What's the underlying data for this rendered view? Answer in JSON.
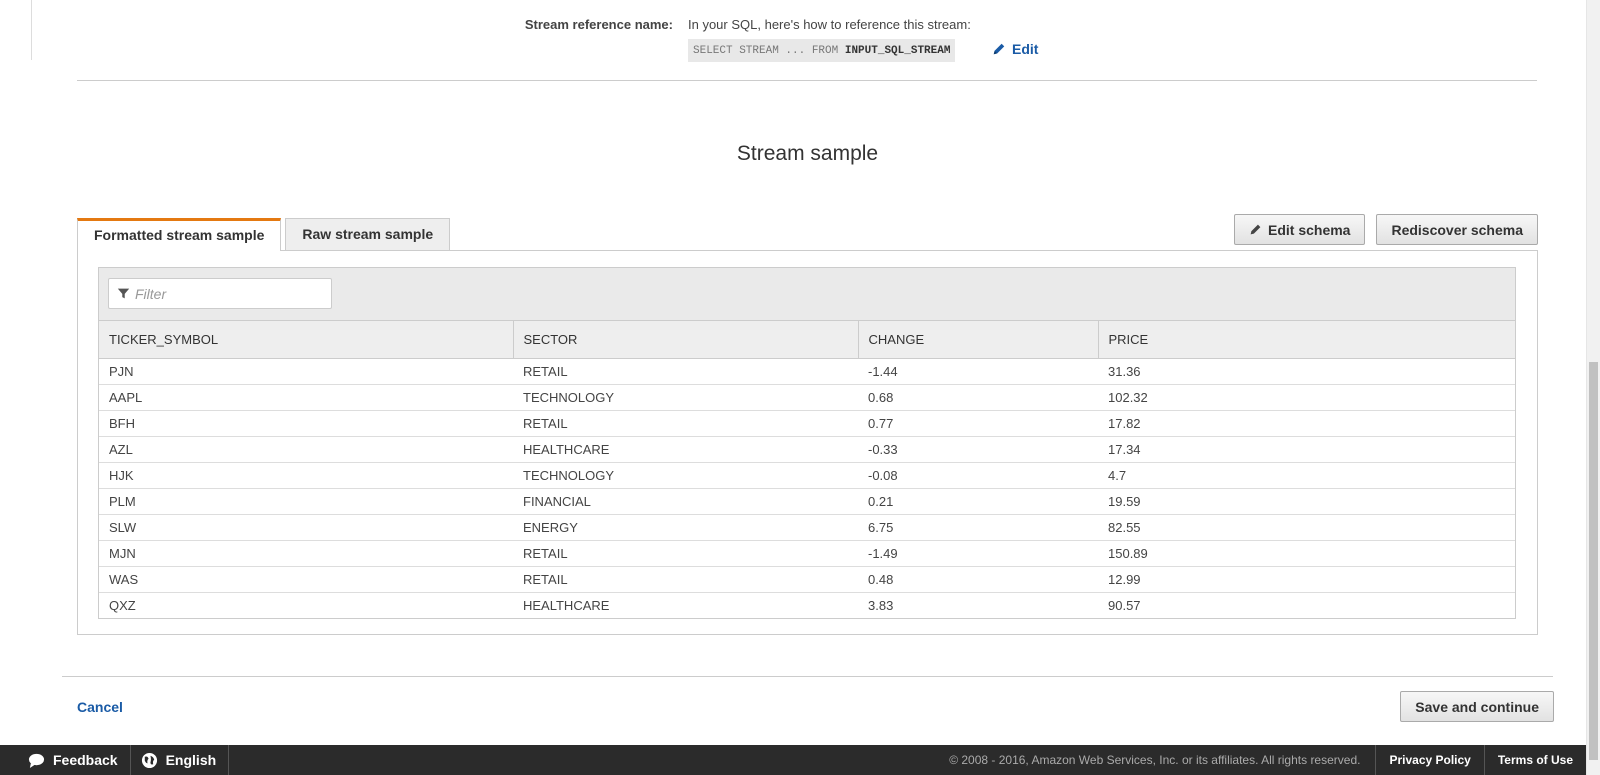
{
  "stream_reference": {
    "label": "Stream reference name:",
    "help_text": "In your SQL, here's how to reference this stream:",
    "code_prefix": "SELECT STREAM ... FROM",
    "code_stream": "INPUT_SQL_STREAM",
    "edit_label": "Edit"
  },
  "section_title": "Stream sample",
  "tabs": [
    {
      "label": "Formatted stream sample",
      "active": true
    },
    {
      "label": "Raw stream sample",
      "active": false
    }
  ],
  "schema_buttons": {
    "edit_schema": "Edit schema",
    "rediscover_schema": "Rediscover schema"
  },
  "filter": {
    "placeholder": "Filter",
    "value": ""
  },
  "table": {
    "columns": [
      "TICKER_SYMBOL",
      "SECTOR",
      "CHANGE",
      "PRICE"
    ],
    "rows": [
      [
        "PJN",
        "RETAIL",
        "-1.44",
        "31.36"
      ],
      [
        "AAPL",
        "TECHNOLOGY",
        "0.68",
        "102.32"
      ],
      [
        "BFH",
        "RETAIL",
        "0.77",
        "17.82"
      ],
      [
        "AZL",
        "HEALTHCARE",
        "-0.33",
        "17.34"
      ],
      [
        "HJK",
        "TECHNOLOGY",
        "-0.08",
        "4.7"
      ],
      [
        "PLM",
        "FINANCIAL",
        "0.21",
        "19.59"
      ],
      [
        "SLW",
        "ENERGY",
        "6.75",
        "82.55"
      ],
      [
        "MJN",
        "RETAIL",
        "-1.49",
        "150.89"
      ],
      [
        "WAS",
        "RETAIL",
        "0.48",
        "12.99"
      ],
      [
        "QXZ",
        "HEALTHCARE",
        "3.83",
        "90.57"
      ]
    ]
  },
  "actions": {
    "cancel": "Cancel",
    "save": "Save and continue"
  },
  "footer": {
    "feedback": "Feedback",
    "language": "English",
    "copyright": "© 2008 - 2016, Amazon Web Services, Inc. or its affiliates. All rights reserved.",
    "privacy": "Privacy Policy",
    "terms": "Terms of Use"
  },
  "colors": {
    "link": "#1a5ba6",
    "active_tab_accent": "#e47911",
    "footer_bg": "#2b2b2b"
  },
  "icons": {
    "edit": "pencil-icon",
    "filter": "filter-icon",
    "feedback": "speech-bubble-icon",
    "language": "globe-icon"
  }
}
